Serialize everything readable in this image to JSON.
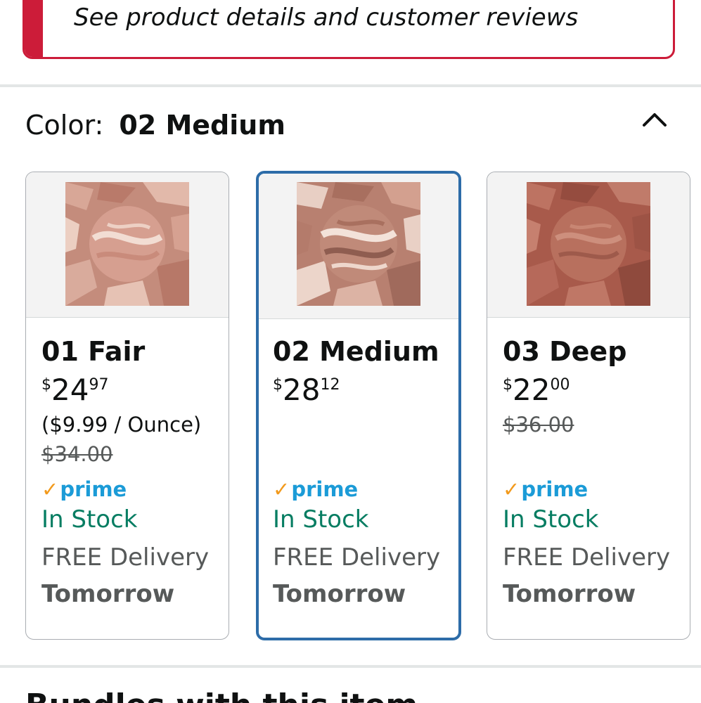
{
  "banner": {
    "text": "See product details and customer reviews"
  },
  "color_selector": {
    "label": "Color:",
    "selected": "02 Medium"
  },
  "variants": [
    {
      "name": "01 Fair",
      "price_symbol": "$",
      "price_whole": "24",
      "price_fraction": "97",
      "unit_price": "($9.99 / Ounce)",
      "list_price": "$34.00",
      "prime": "prime",
      "stock": "In Stock",
      "delivery": "FREE Delivery",
      "delivery_day": "Tomorrow",
      "swatch_colors": {
        "bg": "#c98f7f",
        "disk": "#d9a596",
        "accent": "#efd6cb"
      },
      "selected": false
    },
    {
      "name": "02 Medium",
      "price_symbol": "$",
      "price_whole": "28",
      "price_fraction": "12",
      "unit_price": "",
      "list_price": "",
      "prime": "prime",
      "stock": "In Stock",
      "delivery": "FREE Delivery",
      "delivery_day": "Tomorrow",
      "swatch_colors": {
        "bg": "#b9826f",
        "disk": "#c89582",
        "accent": "#f0dccf"
      },
      "selected": true
    },
    {
      "name": "03 Deep",
      "price_symbol": "$",
      "price_whole": "22",
      "price_fraction": "00",
      "unit_price": "",
      "list_price": "$36.00",
      "prime": "prime",
      "stock": "In Stock",
      "delivery": "FREE Delivery",
      "delivery_day": "Tomorrow",
      "swatch_colors": {
        "bg": "#a6584a",
        "disk": "#b8705d",
        "accent": "#c98a78"
      },
      "selected": false
    }
  ],
  "next_section": {
    "heading": "Bundles with this item"
  },
  "colors": {
    "banner_border": "#cc1c39",
    "selected_border": "#2d6ca8",
    "in_stock": "#067d62",
    "prime_blue": "#1b9bd7",
    "prime_check": "#f29a1c"
  },
  "icons": {
    "collapse": "chevron-up-icon"
  }
}
